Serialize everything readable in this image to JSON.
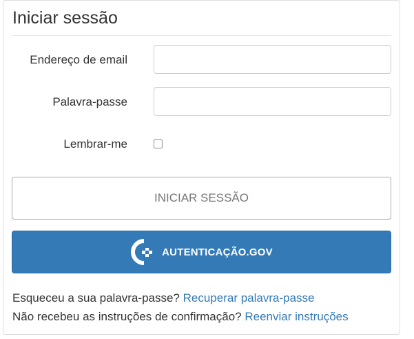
{
  "form": {
    "title": "Iniciar sessão",
    "email_label": "Endereço de email",
    "email_value": "",
    "password_label": "Palavra-passe",
    "password_value": "",
    "remember_label": "Lembrar-me",
    "remember_checked": false,
    "signin_button": "INICIAR SESSÃO",
    "gov_button": "AUTENTICAÇÃO.GOV",
    "gov_icon": "autenticacao-gov-logo"
  },
  "help": {
    "forgot_text": "Esqueceu a sua palavra-passe?",
    "forgot_link": "Recuperar palavra-passe",
    "resend_text": "Não recebeu as instruções de confirmação?",
    "resend_link": "Reenviar instruções"
  },
  "colors": {
    "primary": "#337ab7",
    "link": "#337ab7",
    "text": "#333333"
  }
}
